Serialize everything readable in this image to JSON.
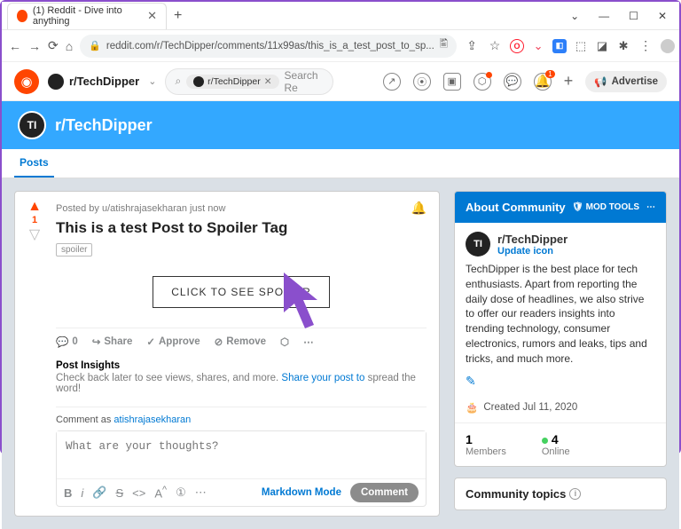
{
  "browser": {
    "tab_title": "(1) Reddit - Dive into anything",
    "url": "reddit.com/r/TechDipper/comments/11x99as/this_is_a_test_post_to_sp..."
  },
  "header": {
    "community": "r/TechDipper",
    "search_pill": "r/TechDipper",
    "search_placeholder": "Search Re",
    "bell_count": "1",
    "advertise": "Advertise"
  },
  "banner": {
    "name": "r/TechDipper",
    "icon_text": "TI"
  },
  "tabs": {
    "posts": "Posts"
  },
  "post": {
    "byline_prefix": "Posted by ",
    "author": "u/atishrajasekharan",
    "byline_suffix": " just now",
    "title": "This is a test Post to Spoiler Tag",
    "tag": "spoiler",
    "spoiler_button": "CLICK TO SEE SPOILER",
    "comments_count": "0",
    "vote_count": "1",
    "share": "Share",
    "approve": "Approve",
    "remove": "Remove",
    "insights_h": "Post Insights",
    "insights_t1": "Check back later to see views, shares, and more. ",
    "insights_link": "Share your post to",
    "insights_t2": " spread the word!",
    "comment_as": "Comment as ",
    "comment_user": "atishrajasekharan",
    "comment_placeholder": "What are your thoughts?",
    "markdown": "Markdown Mode",
    "comment_btn": "Comment"
  },
  "about": {
    "header": "About Community",
    "mod_tools": "MOD TOOLS",
    "name": "r/TechDipper",
    "update": "Update icon",
    "desc": "TechDipper is the best place for tech enthusiasts. Apart from reporting the daily dose of headlines, we also strive to offer our readers insights into trending technology, consumer electronics, rumors and leaks, tips and tricks, and much more.",
    "created": "Created Jul 11, 2020",
    "members_n": "1",
    "members_l": "Members",
    "online_n": "4",
    "online_l": "Online",
    "topics": "Community topics"
  }
}
